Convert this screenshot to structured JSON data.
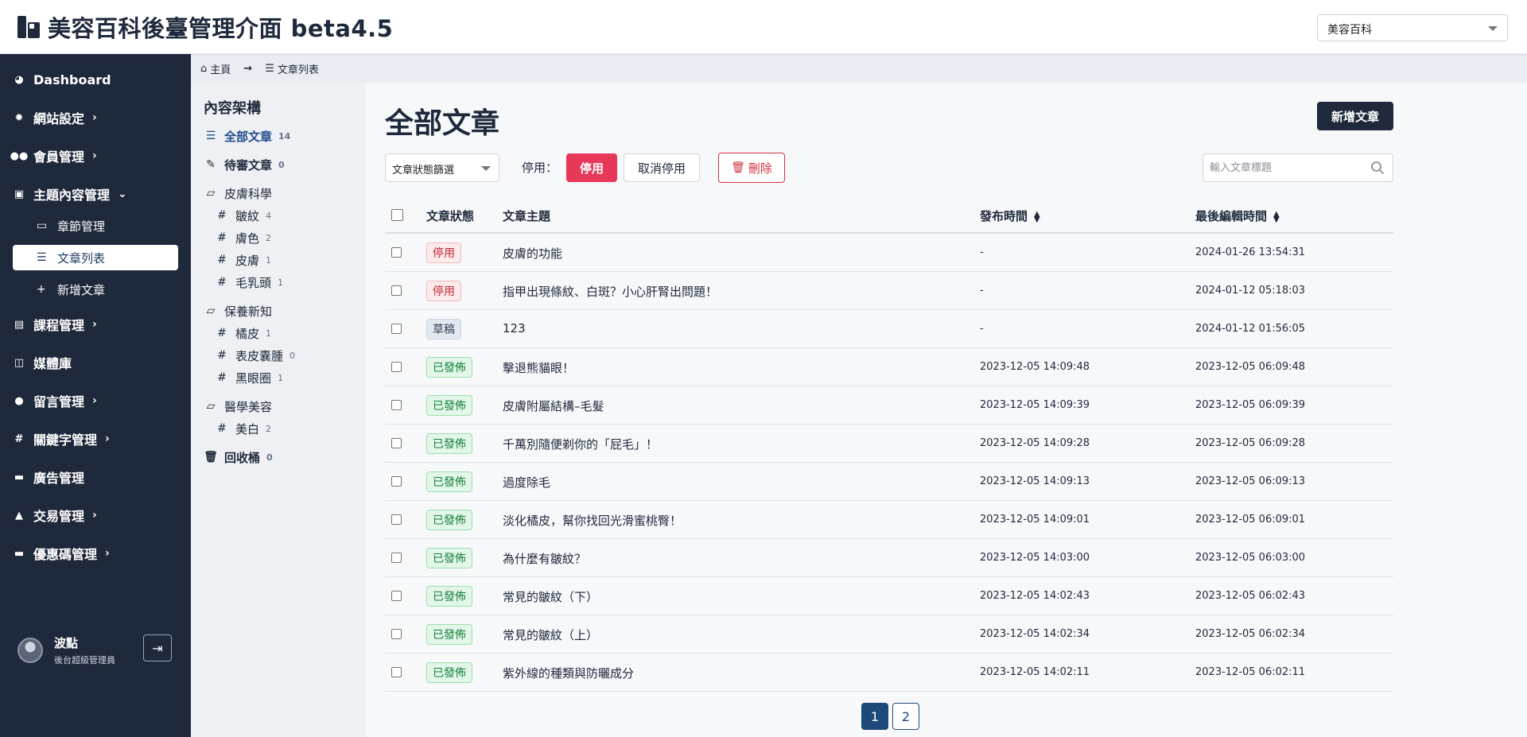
{
  "app": {
    "title": "美容百科後臺管理介面 beta4.5",
    "site_select": "美容百科"
  },
  "sidebar": {
    "items": [
      {
        "label": "Dashboard",
        "icon": "palette-icon",
        "has_children": false
      },
      {
        "label": "網站設定",
        "icon": "gear-icon",
        "has_children": true
      },
      {
        "label": "會員管理",
        "icon": "users-icon",
        "has_children": true
      },
      {
        "label": "主題內容管理",
        "icon": "archive-icon",
        "has_children": true,
        "expanded": true
      },
      {
        "label": "課程管理",
        "icon": "book-icon",
        "has_children": true
      },
      {
        "label": "媒體庫",
        "icon": "images-icon",
        "has_children": false
      },
      {
        "label": "留言管理",
        "icon": "comment-icon",
        "has_children": true
      },
      {
        "label": "關鍵字管理",
        "icon": "hashtag-icon",
        "has_children": true
      },
      {
        "label": "廣告管理",
        "icon": "ad-icon",
        "has_children": false
      },
      {
        "label": "交易管理",
        "icon": "flask-icon",
        "has_children": true
      },
      {
        "label": "優惠碼管理",
        "icon": "ticket-icon",
        "has_children": true
      }
    ],
    "sub_items": [
      {
        "label": "章節管理",
        "icon": "hdd-icon"
      },
      {
        "label": "文章列表",
        "icon": "list-icon",
        "active": true
      },
      {
        "label": "新增文章",
        "icon": "plus-icon"
      }
    ],
    "user": {
      "name": "波點",
      "role": "後台超級管理員"
    }
  },
  "breadcrumb": {
    "home": "主頁",
    "current": "文章列表"
  },
  "categories": {
    "title": "內容架構",
    "all": {
      "label": "全部文章",
      "count": "14"
    },
    "pending": {
      "label": "待審文章",
      "count": "0"
    },
    "groups": [
      {
        "label": "皮膚科學",
        "items": [
          {
            "label": "皺紋",
            "count": "4"
          },
          {
            "label": "膚色",
            "count": "2"
          },
          {
            "label": "皮膚",
            "count": "1"
          },
          {
            "label": "毛乳頭",
            "count": "1"
          }
        ]
      },
      {
        "label": "保養新知",
        "items": [
          {
            "label": "橘皮",
            "count": "1"
          },
          {
            "label": "表皮囊腫",
            "count": "0"
          },
          {
            "label": "黑眼圈",
            "count": "1"
          }
        ]
      },
      {
        "label": "醫學美容",
        "items": [
          {
            "label": "美白",
            "count": "2"
          }
        ]
      }
    ],
    "trash": {
      "label": "回收桶",
      "count": "0"
    }
  },
  "main": {
    "title": "全部文章",
    "add_button": "新增文章",
    "filter_select": "文章狀態篩選",
    "disable_label": "停用：",
    "disable_button": "停用",
    "enable_button": "取消停用",
    "delete_button": "刪除",
    "search_placeholder": "輸入文章標題"
  },
  "table": {
    "headers": {
      "status": "文章狀態",
      "title": "文章主題",
      "published": "發布時間",
      "edited": "最後編輯時間"
    },
    "rows": [
      {
        "status": "停用",
        "status_type": "disabled",
        "title": "皮膚的功能",
        "published": "-",
        "edited": "2024-01-26 13:54:31"
      },
      {
        "status": "停用",
        "status_type": "disabled",
        "title": "指甲出現條紋、白斑？小心肝腎出問題！",
        "published": "-",
        "edited": "2024-01-12 05:18:03"
      },
      {
        "status": "草稿",
        "status_type": "draft",
        "title": "123",
        "published": "-",
        "edited": "2024-01-12 01:56:05"
      },
      {
        "status": "已發佈",
        "status_type": "published",
        "title": "擊退熊貓眼！",
        "published": "2023-12-05 14:09:48",
        "edited": "2023-12-05 06:09:48"
      },
      {
        "status": "已發佈",
        "status_type": "published",
        "title": "皮膚附屬結構–毛髮",
        "published": "2023-12-05 14:09:39",
        "edited": "2023-12-05 06:09:39"
      },
      {
        "status": "已發佈",
        "status_type": "published",
        "title": "千萬別隨便剃你的「屁毛」！",
        "published": "2023-12-05 14:09:28",
        "edited": "2023-12-05 06:09:28"
      },
      {
        "status": "已發佈",
        "status_type": "published",
        "title": "過度除毛",
        "published": "2023-12-05 14:09:13",
        "edited": "2023-12-05 06:09:13"
      },
      {
        "status": "已發佈",
        "status_type": "published",
        "title": "淡化橘皮，幫你找回光滑蜜桃臀！",
        "published": "2023-12-05 14:09:01",
        "edited": "2023-12-05 06:09:01"
      },
      {
        "status": "已發佈",
        "status_type": "published",
        "title": "為什麼有皺紋？",
        "published": "2023-12-05 14:03:00",
        "edited": "2023-12-05 06:03:00"
      },
      {
        "status": "已發佈",
        "status_type": "published",
        "title": "常見的皺紋（下）",
        "published": "2023-12-05 14:02:43",
        "edited": "2023-12-05 06:02:43"
      },
      {
        "status": "已發佈",
        "status_type": "published",
        "title": "常見的皺紋（上）",
        "published": "2023-12-05 14:02:34",
        "edited": "2023-12-05 06:02:34"
      },
      {
        "status": "已發佈",
        "status_type": "published",
        "title": "紫外線的種類與防曬成分",
        "published": "2023-12-05 14:02:11",
        "edited": "2023-12-05 06:02:11"
      }
    ]
  },
  "pagination": {
    "pages": [
      "1",
      "2"
    ],
    "current": "1"
  }
}
